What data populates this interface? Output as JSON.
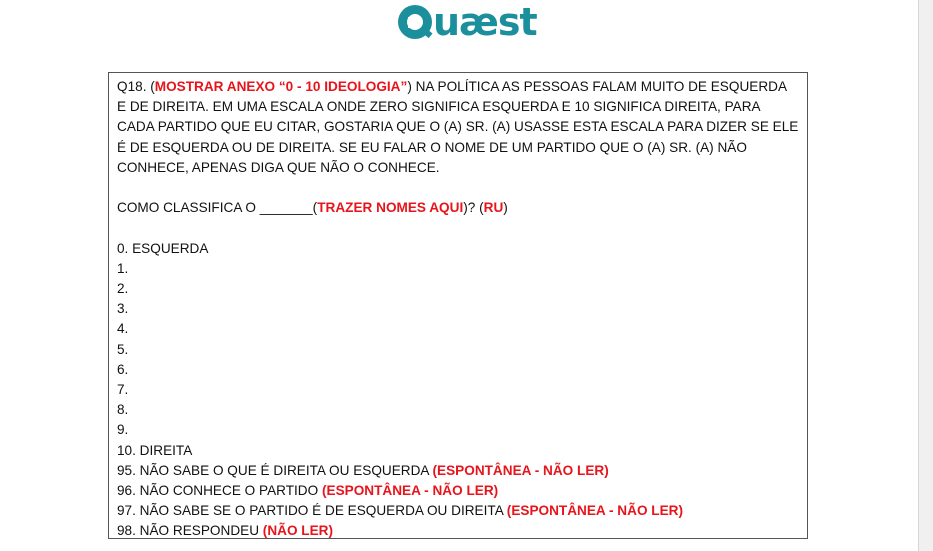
{
  "logo": {
    "first": "Q",
    "rest": "uæst",
    "brand_color": "#1b8f9c"
  },
  "question": {
    "prefix": "Q18. (",
    "instruction": "MOSTRAR ANEXO “0 - 10 IDEOLOGIA”",
    "text_after": ") NA POLÍTICA AS PESSOAS FALAM MUITO DE ESQUERDA",
    "lines": [
      "E DE DIREITA. EM UMA ESCALA ONDE ZERO SIGNIFICA ESQUERDA E 10 SIGNIFICA DIREITA, PARA",
      "CADA PARTIDO QUE EU CITAR, GOSTARIA QUE O (A) SR. (A) USASSE ESTA ESCALA PARA DIZER SE ELE",
      "É DE ESQUERDA OU DE DIREITA. SE EU FALAR O NOME DE UM PARTIDO QUE O (A) SR. (A) NÃO",
      "CONHECE, APENAS DIGA QUE NÃO O CONHECE."
    ],
    "classify_prefix": "COMO CLASSIFICA O _______(",
    "classify_red": "TRAZER NOMES AQUI",
    "classify_mid": ")? (",
    "classify_ru": "RU",
    "classify_end": ")"
  },
  "scale": [
    "0. ESQUERDA",
    "1.",
    "2.",
    "3.",
    "4.",
    "5.",
    "6.",
    "7.",
    "8.",
    "9.",
    "10. DIREITA"
  ],
  "special_options": [
    {
      "text": "95. NÃO SABE O QUE É DIREITA OU ESQUERDA ",
      "note": "(ESPONTÂNEA - NÃO LER)"
    },
    {
      "text": "96. NÃO CONHECE O PARTIDO ",
      "note": "(ESPONTÂNEA - NÃO LER)"
    },
    {
      "text": "97. NÃO SABE SE O PARTIDO É DE ESQUERDA OU DIREITA ",
      "note": "(ESPONTÂNEA - NÃO LER)"
    },
    {
      "text": "98. NÃO RESPONDEU ",
      "note": "(NÃO LER)"
    }
  ],
  "accent_color": "#e8141b"
}
